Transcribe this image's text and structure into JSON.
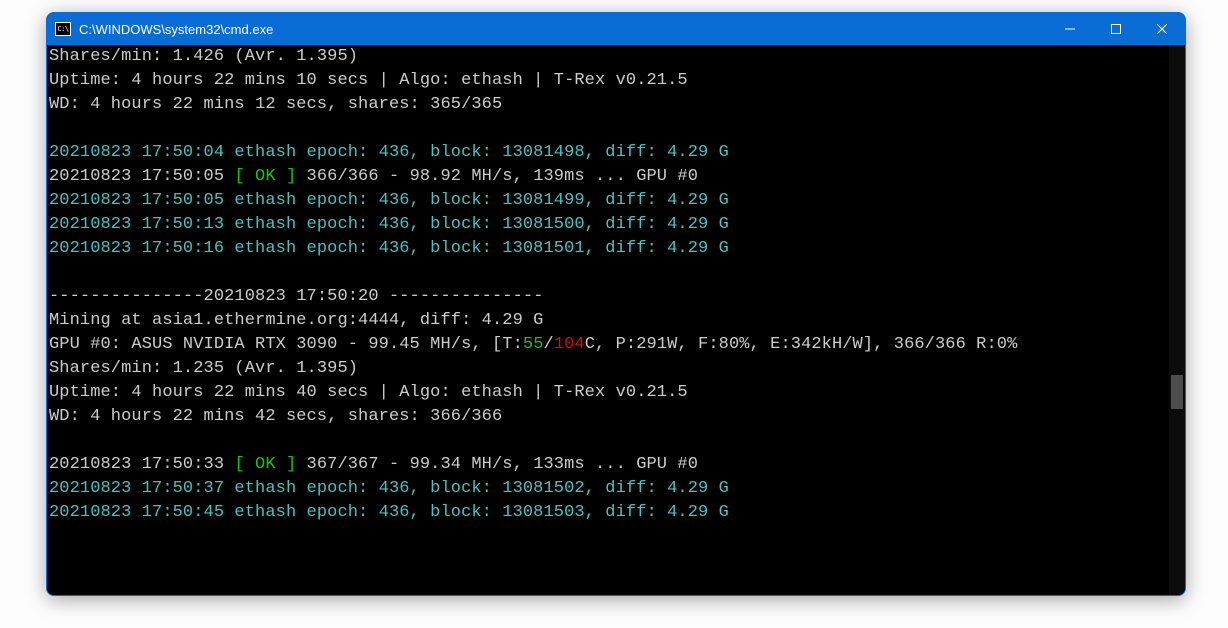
{
  "window": {
    "title": "C:\\WINDOWS\\system32\\cmd.exe",
    "icon_text": "C:\\"
  },
  "lines": {
    "l01a": "Shares/min: 1.426 (Avr. 1.395)",
    "l02a": "Uptime: 4 hours 22 mins 10 secs | Algo: ethash | T-Rex v0.21.5",
    "l03a": "WD: 4 hours 22 mins 12 secs, shares: 365/365",
    "l05a": "20210823 17:50:04 ethash epoch: 436, block: 13081498, diff: 4.29 G",
    "l06a": "20210823 17:50:05 ",
    "l06b": "[ OK ]",
    "l06c": " 366/366 - 98.92 MH/s, 139ms ... GPU #0",
    "l07a": "20210823 17:50:05 ethash epoch: 436, block: 13081499, diff: 4.29 G",
    "l08a": "20210823 17:50:13 ethash epoch: 436, block: 13081500, diff: 4.29 G",
    "l09a": "20210823 17:50:16 ethash epoch: 436, block: 13081501, diff: 4.29 G",
    "l11a": "---------------20210823 17:50:20 ---------------",
    "l12a": "Mining at asia1.ethermine.org:4444, diff: 4.29 G",
    "l13a": "GPU #0: ASUS NVIDIA RTX 3090 - 99.45 MH/s, [T:",
    "l13b": "55",
    "l13c": "/",
    "l13d": "104",
    "l13e": "C, P:291W, F:80%, E:342kH/W], 366/366 R:0%",
    "l14a": "Shares/min: 1.235 (Avr. 1.395)",
    "l15a": "Uptime: 4 hours 22 mins 40 secs | Algo: ethash | T-Rex v0.21.5",
    "l16a": "WD: 4 hours 22 mins 42 secs, shares: 366/366",
    "l18a": "20210823 17:50:33 ",
    "l18b": "[ OK ]",
    "l18c": " 367/367 - 99.34 MH/s, 133ms ... GPU #0",
    "l19a": "20210823 17:50:37 ethash epoch: 436, block: 13081502, diff: 4.29 G",
    "l20a": "20210823 17:50:45 ethash epoch: 436, block: 13081503, diff: 4.29 G"
  }
}
